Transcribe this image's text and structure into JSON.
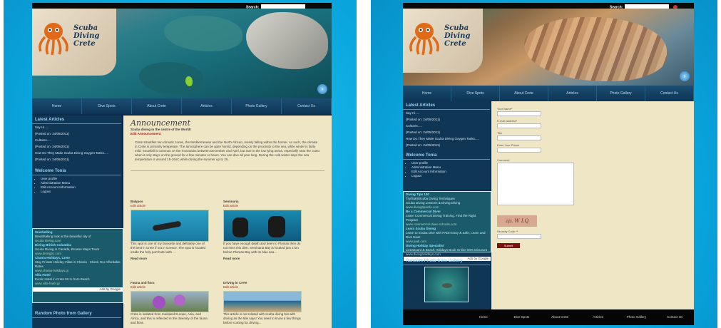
{
  "left": {
    "search_label": "Search:",
    "logo": [
      "Scuba",
      "Diving",
      "Crete"
    ],
    "nav": [
      "Home",
      "Dive Spots",
      "About Crete",
      "Articles",
      "Photo Gallery",
      "Contact Us"
    ],
    "latest_title": "Latest Articles",
    "latest_items": [
      "Say Hi.....",
      "(Posted on: 24/05/2011)",
      "Cultures.....",
      "(Posted on: 24/05/2011)",
      "How Do They Make Scuba Diving Oxygen Tanks.....",
      "(Posted on: 24/05/2011)"
    ],
    "welcome_title": "Welcome Tonia",
    "welcome_items": [
      "User profile",
      "Administration Menu",
      "Edit Account Information",
      "Logout"
    ],
    "widget_lines": [
      "Snorkelling",
      "Breathtaking look at the beautiful city of",
      "Scuba Diving.com",
      "Diving British Columbia",
      "Scuba Diving in Canada, Browse Maps Tours",
      "www.divingbc.com",
      "Chania Holidays, Crete",
      "Stay Private Holiday Villas in Chania - Check Our Affordable Rates",
      "www.chania-holidays.gr",
      "Villa Hotel",
      "Exotic Hotel in Crete 50 m from Beach",
      "www.villa-hotel.gr"
    ],
    "widget_footer": "Ads by Google",
    "random_title": "Random Photo from Gallery",
    "announcement": "Announcement",
    "ann_sub": "Scuba diving in the centre of the World!",
    "edit_ann": "Edit Announcement",
    "ann_body": "Crete straddles two climatic zones, the Mediterranean and the North African, mainly falling within the former. As such, the climate in Crete is primarily temperate. The atmosphere can be quite humid, depending on the proximity to the sea, while winter is fairly mild. Snowfall is common on the mountains between December and April, but rare in the low lying areas, especially near the coast when it only stays on the ground for a few minutes or hours. You can dive all year long. During the cold winter days the sea temperature is around 15-16oC while during the summer up to 26.",
    "cards": [
      {
        "title": "Balypos",
        "edit": "Edit article",
        "text": "This spot is one of my favourite and definitely one of the best in Crete if not in Greece. The spot is located inside the holy port hotel with ...",
        "more": "Read more"
      },
      {
        "title": "Seminaria",
        "edit": "Edit article",
        "text": "If you have enough depth and been to Plomas then do not miss this dive. Seminaria Bay is located just 2 km before Plomas Bay with its blue sea...",
        "more": "Read more"
      },
      {
        "title": "Fauna and flora",
        "edit": "Edit article",
        "text": "Crete is isolated from mainland Europe, Asia, and Africa, and this is reflected in the diversity of the fauna and flora.",
        "more": ""
      },
      {
        "title": "Driving in Crete",
        "edit": "Edit article",
        "text": "This article is not related with scuba diving but with driving as the title says! You need to know a few things before coming for driving...",
        "more": ""
      }
    ]
  },
  "right": {
    "search_label": "Search:",
    "logo": [
      "Scuba",
      "Diving",
      "Crete"
    ],
    "nav": [
      "Home",
      "Dive Spots",
      "About Crete",
      "Articles",
      "Photo Gallery",
      "Contact Us"
    ],
    "latest_title": "Latest Articles",
    "latest_items": [
      "Say Hi.....",
      "(Posted on: 24/05/2011)",
      "Cultures.....",
      "(Posted on: 24/05/2011)",
      "How Do They Make Scuba Diving Oxygen Tanks.....",
      "(Posted on: 24/05/2011)"
    ],
    "welcome_title": "Welcome Tonia",
    "welcome_items": [
      "User profile",
      "Administration Menu",
      "Edit Account Information",
      "Logout"
    ],
    "widget_lines": [
      "Diving Tips 100",
      "Try/Start/Scuba Diving Techniques",
      "Scuba Diving Lessons & Diving Diving",
      "www.divingtipsinfo.com",
      "Be a Commercial Diver",
      "Learn Commercial Diving Training. Find the Right Program",
      "www.commercial-diver-schools.com",
      "Learn Scuba Diving",
      "Learn to Scuba Dive with PADI! Easy & Safe, Learn and Dive Now!",
      "www.padi.com",
      "Diving Holiday Specialist",
      "Liveaboard & Beach Holidays Book Online 50% Discount",
      "www.divingholidays.com"
    ],
    "widget_footer": "Ads by Google",
    "random_title": "Random Photo from Gallery",
    "form": [
      "Your Name*",
      "E-mail address*",
      "Title",
      "Enter Your Phone",
      "Comment"
    ],
    "captcha_text": "zp. W LQ",
    "security_label": "Security Code **",
    "submit": "Submit",
    "footer_nav": [
      "Home",
      "Dive Spots",
      "About Crete",
      "Articles",
      "Photo Gallery",
      "Contact Us"
    ]
  }
}
